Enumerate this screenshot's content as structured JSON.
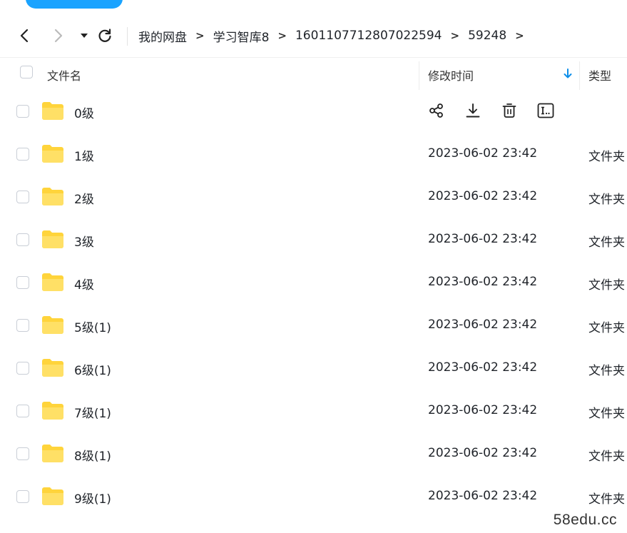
{
  "toolbar": {
    "breadcrumbs": [
      "我的网盘",
      "学习智库8",
      "1601107712807022594",
      "59248"
    ],
    "separator": ">"
  },
  "header": {
    "name": "文件名",
    "modified": "修改时间",
    "type": "类型"
  },
  "files": [
    {
      "name": "0级",
      "time": "",
      "type": "",
      "hovered": true
    },
    {
      "name": "1级",
      "time": "2023-06-02 23:42",
      "type": "文件夹"
    },
    {
      "name": "2级",
      "time": "2023-06-02 23:42",
      "type": "文件夹"
    },
    {
      "name": "3级",
      "time": "2023-06-02 23:42",
      "type": "文件夹"
    },
    {
      "name": "4级",
      "time": "2023-06-02 23:42",
      "type": "文件夹"
    },
    {
      "name": "5级(1)",
      "time": "2023-06-02 23:42",
      "type": "文件夹"
    },
    {
      "name": "6级(1)",
      "time": "2023-06-02 23:42",
      "type": "文件夹"
    },
    {
      "name": "7级(1)",
      "time": "2023-06-02 23:42",
      "type": "文件夹"
    },
    {
      "name": "8级(1)",
      "time": "2023-06-02 23:42",
      "type": "文件夹"
    },
    {
      "name": "9级(1)",
      "time": "2023-06-02 23:42",
      "type": "文件夹"
    }
  ],
  "row_actions": [
    "share-icon",
    "download-icon",
    "delete-icon",
    "rename-icon"
  ],
  "watermark": "58edu.cc",
  "colors": {
    "accent": "#1aa3ff",
    "sort_arrow": "#0d8ee9",
    "folder": "#ffd43b"
  }
}
